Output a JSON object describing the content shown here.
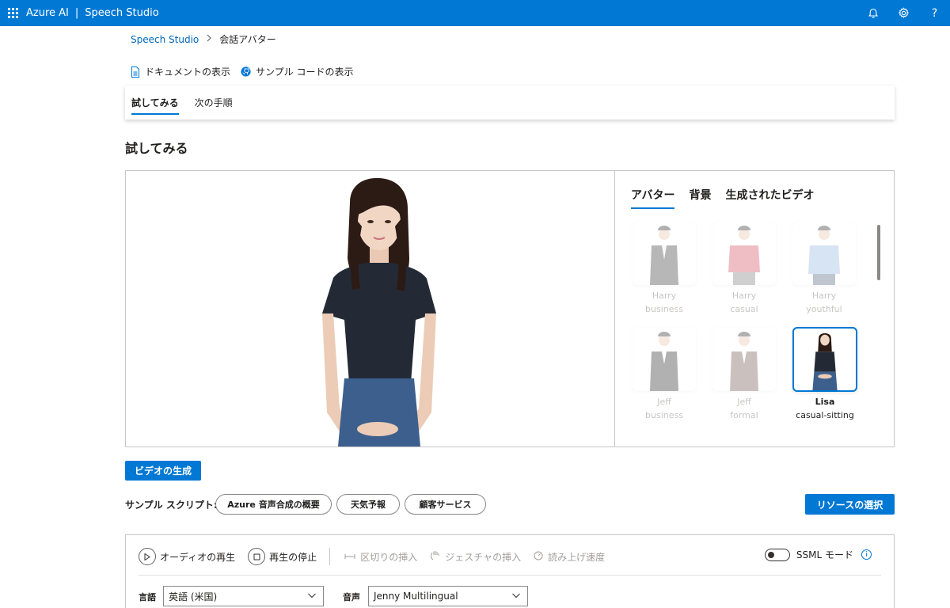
{
  "topbar": {
    "product": "Azure AI",
    "separator": "|",
    "app": "Speech Studio",
    "icons": [
      "bell-icon",
      "gear-icon",
      "help-icon"
    ],
    "help_glyph": "?"
  },
  "breadcrumb": {
    "root": "Speech Studio",
    "current": "会話アバター"
  },
  "doc_links": {
    "docs": "ドキュメントの表示",
    "sample_code": "サンプル コードの表示"
  },
  "pivots": [
    "試してみる",
    "次の手順"
  ],
  "section_title": "試してみる",
  "side_tabs": [
    "アバター",
    "背景",
    "生成されたビデオ"
  ],
  "avatars": [
    {
      "name": "Harry",
      "style": "business"
    },
    {
      "name": "Harry",
      "style": "casual"
    },
    {
      "name": "Harry",
      "style": "youthful"
    },
    {
      "name": "Jeff",
      "style": "business"
    },
    {
      "name": "Jeff",
      "style": "formal"
    },
    {
      "name": "Lisa",
      "style": "casual-sitting"
    }
  ],
  "selected_avatar": "Lisa",
  "actions": {
    "generate_video": "ビデオの生成",
    "select_resource": "リソースの選択"
  },
  "sample_scripts": {
    "label": "サンプル スクリプト:",
    "chips": [
      "Azure 音声合成の概要",
      "天気予報",
      "顧客サービス"
    ]
  },
  "editor": {
    "play_audio": "オーディオの再生",
    "stop_play": "再生の停止",
    "insert_break": "区切りの挿入",
    "insert_gesture": "ジェスチャの挿入",
    "reading_speed": "読み上げ速度",
    "ssml_mode": "SSML モード",
    "language_label": "言語",
    "language_value": "英語 (米国)",
    "voice_label": "音声",
    "voice_value": "Jenny Multilingual"
  },
  "colors": {
    "accent": "#0078d4",
    "topbar": "#0078d4"
  }
}
